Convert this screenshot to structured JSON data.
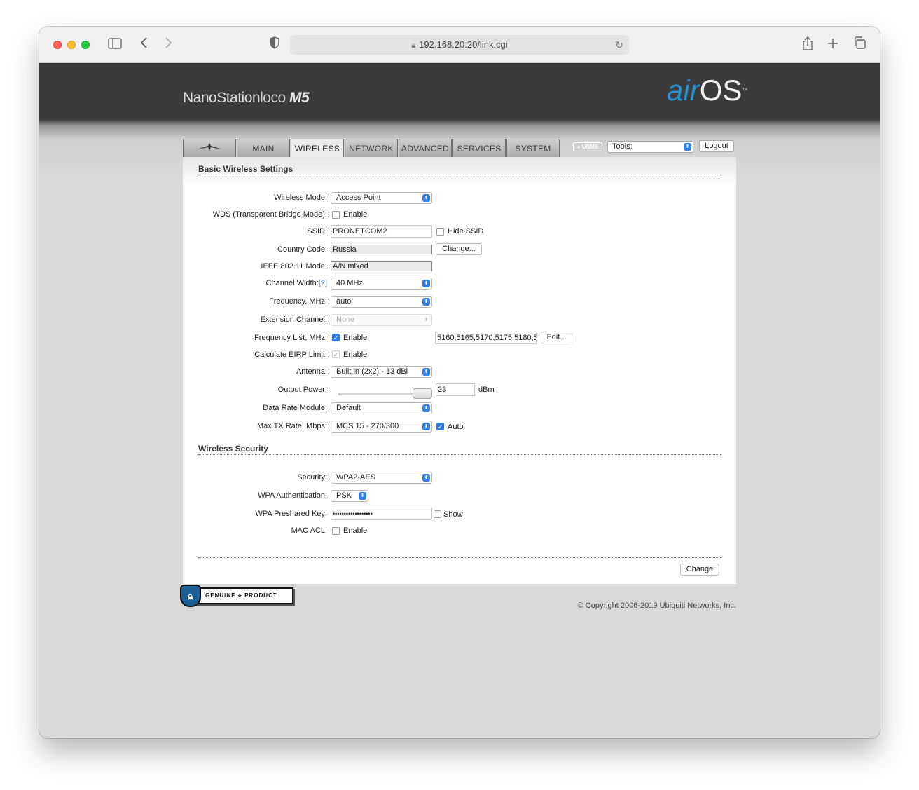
{
  "browser": {
    "url": "192.168.20.20/link.cgi"
  },
  "header": {
    "brand_name": "NanoStation",
    "brand_loco": "loco",
    "brand_model": "M5",
    "airos_air": "air",
    "airos_os": "OS",
    "airos_tm": "™",
    "tabs": [
      {
        "label": "",
        "icon": "ubiquiti-logo-icon"
      },
      {
        "label": "MAIN"
      },
      {
        "label": "WIRELESS",
        "active": true
      },
      {
        "label": "NETWORK"
      },
      {
        "label": "ADVANCED"
      },
      {
        "label": "SERVICES"
      },
      {
        "label": "SYSTEM"
      }
    ],
    "unms_label": "UNMS",
    "tools_label": "Tools:",
    "logout_label": "Logout"
  },
  "basic": {
    "section_title": "Basic Wireless Settings",
    "wireless_mode_label": "Wireless Mode:",
    "wireless_mode_value": "Access Point",
    "wds_label": "WDS (Transparent Bridge Mode):",
    "wds_enable": "Enable",
    "ssid_label": "SSID:",
    "ssid_value": "PRONETCOM2",
    "hide_ssid": "Hide SSID",
    "country_label": "Country Code:",
    "country_value": "Russia",
    "change_btn": "Change...",
    "ieee_label": "IEEE 802.11 Mode:",
    "ieee_value": "A/N mixed",
    "channel_width_label": "Channel Width:",
    "channel_width_help": "[?]",
    "channel_width_value": "40 MHz",
    "frequency_label": "Frequency, MHz:",
    "frequency_value": "auto",
    "extension_label": "Extension Channel:",
    "extension_value": "None",
    "freq_list_label": "Frequency List, MHz:",
    "freq_list_enable": "Enable",
    "freq_list_value": "5160,5165,5170,5175,5180,5",
    "edit_btn": "Edit...",
    "eirp_label": "Calculate EIRP Limit:",
    "eirp_enable": "Enable",
    "antenna_label": "Antenna:",
    "antenna_value": "Built in (2x2) - 13 dBi",
    "output_power_label": "Output Power:",
    "output_power_value": "23",
    "output_power_unit": "dBm",
    "data_rate_label": "Data Rate Module:",
    "data_rate_value": "Default",
    "max_tx_label": "Max TX Rate, Mbps:",
    "max_tx_value": "MCS 15 - 270/300",
    "max_tx_auto": "Auto"
  },
  "security": {
    "section_title": "Wireless Security",
    "security_label": "Security:",
    "security_value": "WPA2-AES",
    "wpa_auth_label": "WPA Authentication:",
    "wpa_auth_value": "PSK",
    "psk_label": "WPA Preshared Key:",
    "psk_value": "••••••••••••••••••",
    "show_label": "Show",
    "mac_acl_label": "MAC ACL:",
    "mac_acl_enable": "Enable"
  },
  "footer": {
    "change_btn": "Change",
    "genuine_text": "GENUINE ⟡ PRODUCT",
    "copyright": "© Copyright 2006-2019 Ubiquiti Networks, Inc."
  }
}
